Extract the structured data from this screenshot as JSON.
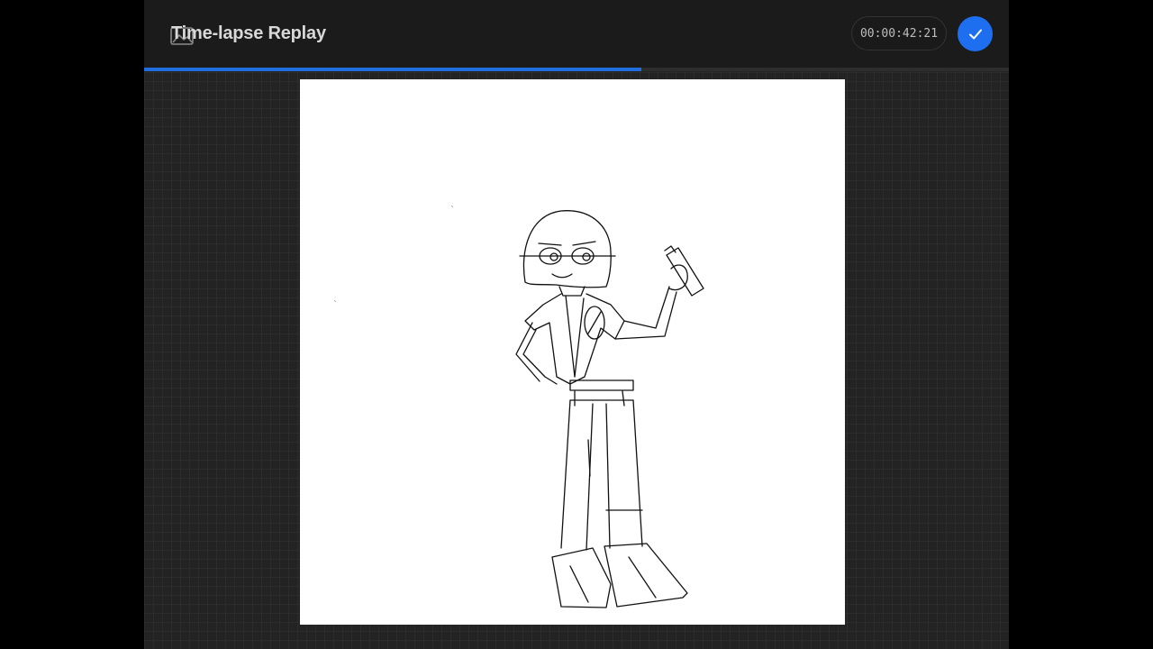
{
  "header": {
    "title": "Time-lapse Replay",
    "timestamp": "00:00:42:21",
    "progress_fraction": 0.575,
    "accent_color": "#1f6fe0"
  },
  "icons": {
    "title_icon": "photos-icon",
    "done_icon": "checkmark-icon"
  },
  "canvas": {
    "content": "line-art sketch of a character holding a spray can",
    "background": "#ffffff"
  }
}
